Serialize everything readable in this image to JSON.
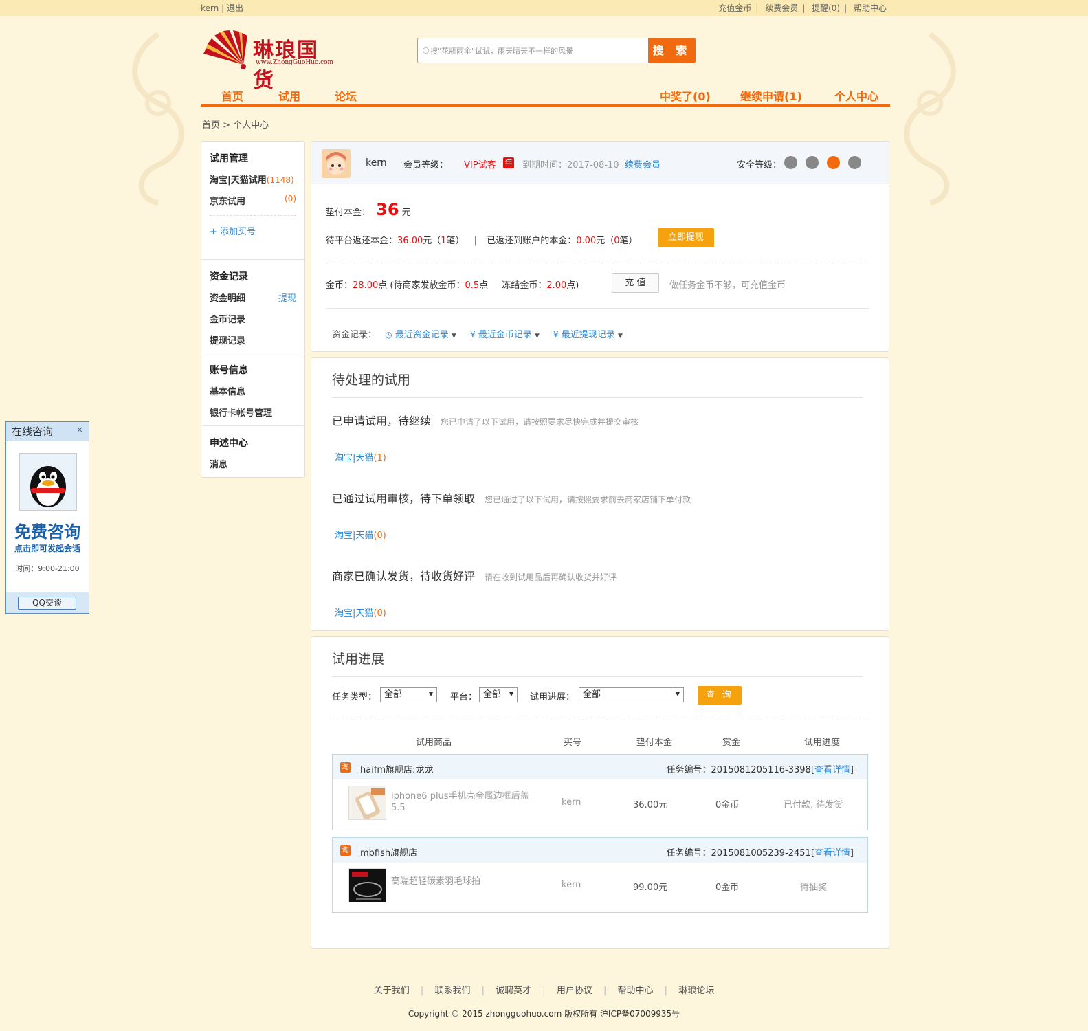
{
  "colors": {
    "accent": "#f26a0f",
    "brand": "#c3121e",
    "link": "#2b8ad6",
    "price": "#e8110f",
    "bg": "#fdf5dc",
    "withdraw_button": "#f6a20f"
  },
  "topbar": {
    "user": "kern",
    "sep": "|",
    "logout": "退出",
    "links": [
      "充值金币",
      "续费会员",
      "提醒(0)",
      "帮助中心"
    ]
  },
  "logo": {
    "brand": "琳琅国货",
    "url": "www.ZhongGuoHuo.com"
  },
  "search": {
    "placeholder": "搜\"花瓶雨伞\"试试，雨天晴天不一样的风景",
    "button": "搜 索"
  },
  "nav": {
    "left": [
      "首页",
      "试用",
      "论坛"
    ],
    "right": [
      "中奖了(0)",
      "继续申请(1)",
      "个人中心"
    ]
  },
  "breadcrumb": {
    "home": "首页",
    "sep": ">",
    "current": "个人中心"
  },
  "sidebar": {
    "trial": {
      "title": "试用管理",
      "tb": "淘宝|天猫试用",
      "tb_count": "(1148)",
      "jd": "京东试用",
      "jd_count": "(0)",
      "add": "+ 添加买号"
    },
    "funds": {
      "title": "资金记录",
      "detail": "资金明细",
      "withdraw": "提现",
      "gold": "金币记录",
      "withdraw_log": "提现记录"
    },
    "account": {
      "title": "账号信息",
      "basic": "基本信息",
      "bank": "银行卡帐号管理"
    },
    "appeal": {
      "title": "申述中心",
      "msg": "消息"
    }
  },
  "user": {
    "name": "kern",
    "level_label": "会员等级：",
    "level": "VIP试客",
    "year_badge": "年",
    "expire": "到期时间：2017-08-10",
    "renew": "续费会员",
    "security": "安全等级：",
    "security_icons": [
      "id-card-icon",
      "phone-icon",
      "mail-icon",
      "document-icon"
    ]
  },
  "funds": {
    "principal_label": "垫付本金：",
    "principal": "36",
    "principal_unit": "元",
    "pending_label": "待平台返还本金：",
    "pending_amount": "36.00",
    "yuan": "元",
    "pending_open": "（",
    "pending_cnt": "1",
    "bi": "笔",
    "pending_close": "）",
    "bar": "|",
    "returned_label": "已返还到账户的本金：",
    "returned_amount": "0.00",
    "returned_open": "（",
    "returned_cnt": "0",
    "returned_close": "）",
    "withdraw_btn": "立即提现",
    "gold_label": "金币：",
    "gold": "28.00",
    "dian": "点",
    "gold_pending_label": "(待商家发放金币：",
    "gold_pending": "0.5",
    "frozen_label": "冻结金币：",
    "frozen": "2.00",
    "frozen_close": "点)",
    "recharge_btn": "充 值",
    "recharge_tip": "做任务金币不够，可充值金币",
    "records_label": "资金记录：",
    "rec1": "最近资金记录",
    "rec2": "最近金币记录",
    "rec3": "最近提现记录"
  },
  "pending": {
    "title": "待处理的试用",
    "s1": {
      "title": "已申请试用，待继续",
      "sub": "您已申请了以下试用，请按照要求尽快完成并提交审核",
      "link": "淘宝|天猫",
      "count": "(1)"
    },
    "s2": {
      "title": "已通过试用审核，待下单领取",
      "sub": "您已通过了以下试用，请按照要求前去商家店铺下单付款",
      "link": "淘宝|天猫",
      "count": "(0)"
    },
    "s3": {
      "title": "商家已确认发货，待收货好评",
      "sub": "请在收到试用品后再确认收货并好评",
      "link": "淘宝|天猫",
      "count": "(0)"
    }
  },
  "progress": {
    "title": "试用进展",
    "filter": {
      "type_label": "任务类型：",
      "type": "全部",
      "platform_label": "平台：",
      "platform": "全部",
      "stage_label": "试用进展：",
      "stage": "全部",
      "query": "查 询"
    },
    "headers": [
      "试用商品",
      "买号",
      "垫付本金",
      "赏金",
      "试用进度"
    ],
    "orders": [
      {
        "platform_icon": "淘",
        "shop": "haifm旗舰店:龙龙",
        "task_label": "任务编号：",
        "task_no": "2015081205116-3398",
        "open": "[",
        "detail": "查看详情",
        "close": "]",
        "product": "iphone6 plus手机壳金属边框后盖5.5",
        "buyer": "kern",
        "principal": "36.00元",
        "reward": "0金币",
        "status": "已付款, 待发货"
      },
      {
        "platform_icon": "淘",
        "shop": "mbfish旗舰店",
        "task_label": "任务编号：",
        "task_no": "2015081005239-2451",
        "open": "[",
        "detail": "查看详情",
        "close": "]",
        "product": "高端超轻碳素羽毛球拍",
        "buyer": "kern",
        "principal": "99.00元",
        "reward": "0金币",
        "status": "待抽奖"
      }
    ]
  },
  "qq": {
    "title": "在线咨询",
    "close": "×",
    "free": "免费咨询",
    "sub": "点击即可发起会话",
    "time": "时间：9:00-21:00",
    "btn": "QQ交谈"
  },
  "footer": {
    "links": [
      "关于我们",
      "联系我们",
      "诚聘英才",
      "用户协议",
      "帮助中心",
      "琳琅论坛"
    ],
    "sep": "|",
    "copyright": "Copyright © 2015 zhongguohuo.com 版权所有 沪ICP备07009935号"
  }
}
